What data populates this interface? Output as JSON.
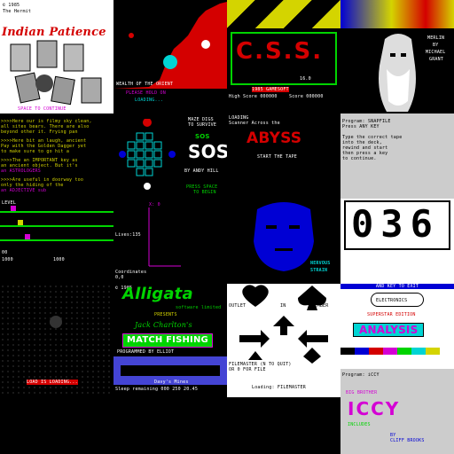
{
  "gallery": {
    "tiles": [
      {
        "id": "indian-patience",
        "lines": [
          "© 1985",
          "The Hermit",
          "Indian Patience",
          "SPACE TO CONTINUE"
        ],
        "title": "Indian Patience"
      },
      {
        "id": "wealth-of-the-orient",
        "lines": [
          "WEALTH OF THE ORIENT",
          "PLEASE HOLD ON",
          "LOADING..."
        ]
      },
      {
        "id": "css",
        "lines": [
          "C.S.S.",
          "16.0",
          "1985 GAMESOFT",
          "High Score 000000",
          "Score 000000"
        ],
        "title": "C.S.S."
      },
      {
        "id": "merlin",
        "lines": [
          "MERLIN",
          "BY",
          "MICHAEL",
          "GRANT"
        ]
      },
      {
        "id": "adventure-text",
        "lines": [
          ">>>>Here our is filmy sky clean, ",
          "all sites bears. There are also",
          "beyond other it. Frying pan",
          ">>>>Here bit an laugh, ancient",
          "Pay with the Golden Dagger yet",
          "to make sure to go hit a",
          ">>>>The an IMPORTANT key as",
          "an ancient object. But it's",
          "an ASTROLOGERS",
          ">>>>Are useful in doorway too",
          "only the hiding of the",
          "an ADJECTIVE sub"
        ]
      },
      {
        "id": "sos",
        "lines": [
          "MAZE DIGS",
          "TO SURVIVE",
          "SOS",
          "SOS",
          "BY ANDY HILL",
          "PRESS SPACE",
          "TO BEGIN"
        ],
        "title": "SOS"
      },
      {
        "id": "abyss",
        "lines": [
          "LOADING",
          "Scanner Across the",
          "ABYSS",
          "START THE TAPE"
        ],
        "title": "ABYSS"
      },
      {
        "id": "program-prompt",
        "lines": [
          "Program: SNAPFILE",
          "Press ANY KEY",
          "",
          "Type the correct tape",
          "into the deck,",
          "rewind and start",
          "then press a key",
          "to continue."
        ]
      },
      {
        "id": "ladders",
        "lines": [
          "LEVEL",
          "00",
          "1000",
          "1000"
        ]
      },
      {
        "id": "plotter",
        "lines": [
          "X: 0",
          "Lives:135",
          "Coordinates",
          "0,0"
        ]
      },
      {
        "id": "portrait",
        "lines": [
          "NERVOUS",
          "STRAIN"
        ]
      },
      {
        "id": "counter",
        "lines": [
          "036"
        ],
        "title": "036"
      },
      {
        "id": "dark-pattern",
        "lines": [
          "LOAD IS LOADING..."
        ]
      },
      {
        "id": "match-fishing",
        "lines": [
          "© 1985",
          "Alligata",
          "software limited",
          "PRESENTS",
          "Jack Charlton's",
          "MATCH FISHING",
          "PROGRAMMED BY ELLIOT",
          "GREY",
          "Davy's Mines",
          "Sleep remaining 000 250 20.45"
        ],
        "title": "MATCH FISHING"
      },
      {
        "id": "suits",
        "lines": [
          "OUTLET",
          "IN",
          "CLIMBER",
          "FILEMASTER (N TO QUIT)",
          "OR 0 FOR FILE",
          "Loading: FILEMASTER"
        ]
      },
      {
        "id": "analysis",
        "lines": [
          "AND KEY TO EXIT",
          "ELECTRONICS",
          "SUPERSTAR EDITION",
          "ANALYSIS"
        ],
        "title": "ANALYSIS"
      },
      {
        "id": "iccy",
        "lines": [
          "Program: iCCY",
          "BIG BROTHER",
          "ICCY",
          "INCLUDES",
          "BY",
          "CLIFF BROOKS"
        ],
        "title": "ICCY"
      }
    ]
  },
  "colors": {
    "black": "#000000",
    "white": "#ffffff",
    "red": "#d40000",
    "green": "#00d400",
    "blue": "#0000d4",
    "cyan": "#00d4d4",
    "yellow": "#d4d400",
    "magenta": "#d400d4",
    "grey": "#cccccc"
  }
}
